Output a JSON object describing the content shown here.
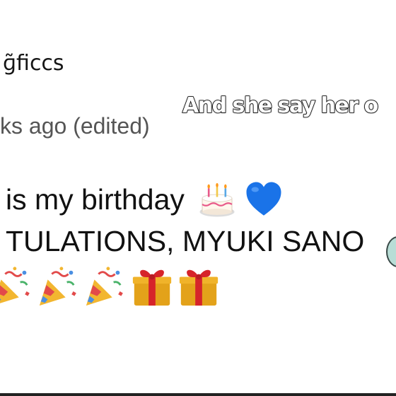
{
  "comment": {
    "username": "ɡ̃ficcs",
    "timestamp": "ks ago (edited)",
    "line1_text": "is my birthday",
    "line2_text": "TULATIONS, MYUKI SANO"
  },
  "overlay": {
    "caption": "And she say her o"
  },
  "icons": {
    "inline": [
      "birthday-cake-icon",
      "blue-heart-icon"
    ],
    "row": [
      "party-popper-icon",
      "party-popper-icon",
      "party-popper-icon",
      "gift-icon",
      "gift-icon"
    ]
  },
  "colors": {
    "text": "#111111",
    "timestamp": "#555555",
    "heart": "#1a73e8",
    "gift_box": "#e3a21a",
    "gift_ribbon": "#d6242a",
    "caption_fill": "#ffffff",
    "caption_stroke": "#000000"
  }
}
